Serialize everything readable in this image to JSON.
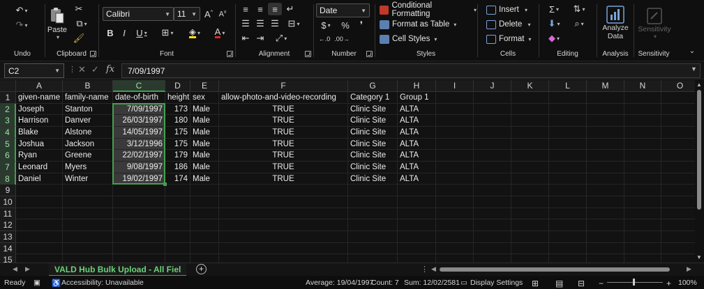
{
  "ribbon": {
    "undo": {
      "label": "Undo"
    },
    "clipboard": {
      "label": "Clipboard",
      "paste_label": "Paste"
    },
    "font": {
      "label": "Font",
      "font_name": "Calibri",
      "font_size": "11"
    },
    "alignment": {
      "label": "Alignment"
    },
    "number": {
      "label": "Number",
      "format": "Date"
    },
    "styles": {
      "label": "Styles",
      "conditional_formatting": "Conditional Formatting",
      "format_as_table": "Format as Table",
      "cell_styles": "Cell Styles"
    },
    "cells": {
      "label": "Cells",
      "insert": "Insert",
      "delete": "Delete",
      "format": "Format"
    },
    "editing": {
      "label": "Editing"
    },
    "analysis": {
      "label": "Analysis",
      "analyze_data": "Analyze Data"
    },
    "sensitivity": {
      "label": "Sensitivity",
      "button": "Sensitivity"
    },
    "analyze_line1": "Analyze",
    "analyze_line2": "Data"
  },
  "formula_bar": {
    "name_box": "C2",
    "formula": "7/09/1997",
    "fx": "fx"
  },
  "columns": [
    "A",
    "B",
    "C",
    "D",
    "E",
    "F",
    "G",
    "H",
    "I",
    "J",
    "K",
    "L",
    "M",
    "N",
    "O"
  ],
  "rows": [
    "1",
    "2",
    "3",
    "4",
    "5",
    "6",
    "7",
    "8",
    "9",
    "10",
    "11",
    "12",
    "13",
    "14",
    "15"
  ],
  "table": {
    "headers": [
      "given-name",
      "family-name",
      "date-of-birth",
      "height",
      "sex",
      "allow-photo-and-video-recording",
      "Category 1",
      "Group 1"
    ],
    "rows": [
      [
        "Joseph",
        "Stanton",
        "7/09/1997",
        "173",
        "Male",
        "TRUE",
        "Clinic Site",
        "ALTA"
      ],
      [
        "Harrison",
        "Danver",
        "26/03/1997",
        "180",
        "Male",
        "TRUE",
        "Clinic Site",
        "ALTA"
      ],
      [
        "Blake",
        "Alstone",
        "14/05/1997",
        "175",
        "Male",
        "TRUE",
        "Clinic Site",
        "ALTA"
      ],
      [
        "Joshua",
        "Jackson",
        "3/12/1996",
        "175",
        "Male",
        "TRUE",
        "Clinic Site",
        "ALTA"
      ],
      [
        "Ryan",
        "Greene",
        "22/02/1997",
        "179",
        "Male",
        "TRUE",
        "Clinic Site",
        "ALTA"
      ],
      [
        "Leonard",
        "Myers",
        "9/08/1997",
        "186",
        "Male",
        "TRUE",
        "Clinic Site",
        "ALTA"
      ],
      [
        "Daniel",
        "Winter",
        "19/02/1997",
        "174",
        "Male",
        "TRUE",
        "Clinic Site",
        "ALTA"
      ]
    ]
  },
  "sheet_tab": "VALD Hub Bulk Upload - All Fiel",
  "status_bar": {
    "ready": "Ready",
    "accessibility": "Accessibility: Unavailable",
    "average": "Average: 19/04/1997",
    "count": "Count: 7",
    "sum": "Sum: 12/02/2581",
    "display_settings": "Display Settings",
    "zoom": "100%"
  },
  "colors": {
    "accent": "#44a04f",
    "ribbon_bg": "#0f0f0f",
    "grid_bg": "#121212"
  }
}
